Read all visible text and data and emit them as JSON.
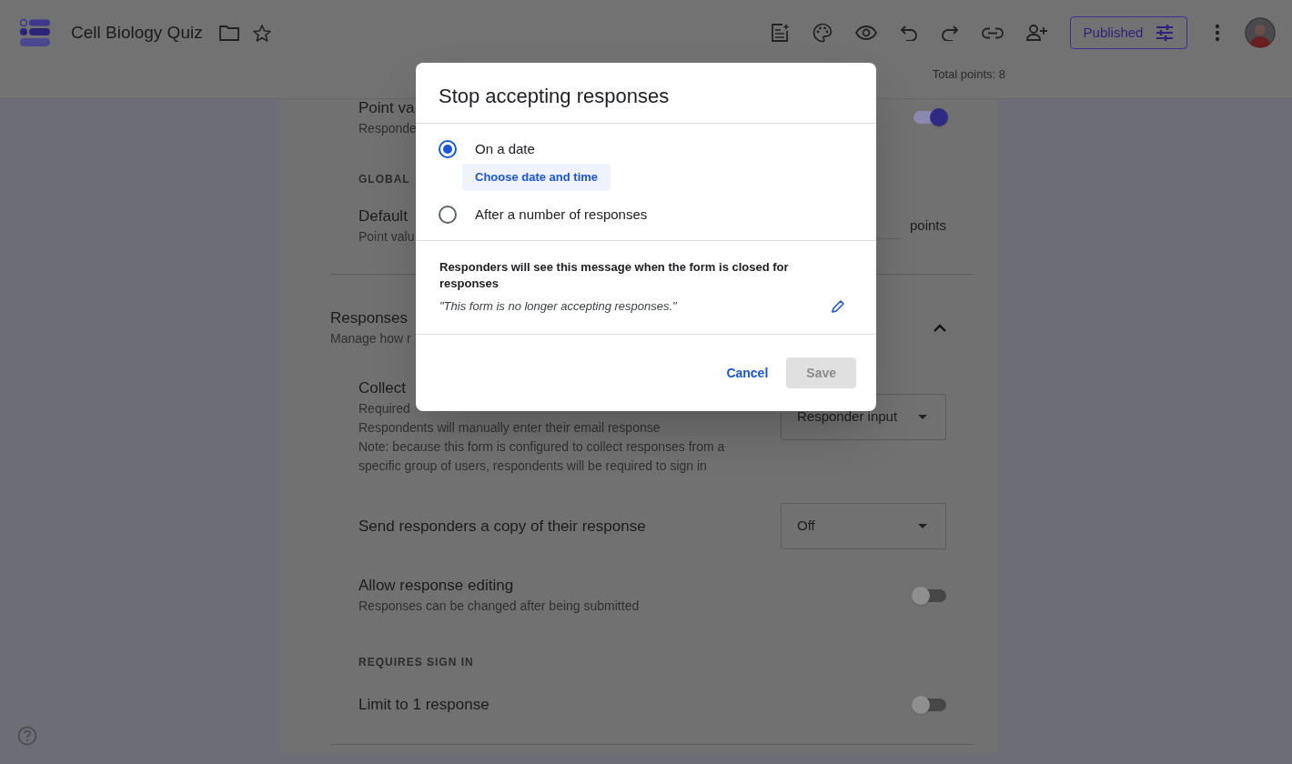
{
  "app": {
    "title": "Cell Biology Quiz",
    "starred": false,
    "publish_button": "Published",
    "total_points": "Total points: 8"
  },
  "settings": [
    {
      "kind": "toggle",
      "title": "Point va",
      "lines": [
        "Responde"
      ],
      "on": true
    },
    {
      "kind": "heading",
      "label": "GLOBAL"
    },
    {
      "kind": "points",
      "title": "Default",
      "lines": [
        "Point valu"
      ],
      "unit": "points"
    },
    {
      "kind": "section",
      "title": "Responses",
      "lines": [
        "Manage how r"
      ],
      "expanded": true
    },
    {
      "kind": "dropdown",
      "title": "Collect",
      "lines": [
        "Required",
        "Respondents will manually enter their email response",
        "Note: because this form is configured to collect responses from a specific group of users, respondents will be required to sign in"
      ],
      "value": "Responder input"
    },
    {
      "kind": "dropdown",
      "title": "Send responders a copy of their response",
      "value": "Off"
    },
    {
      "kind": "toggle",
      "title": "Allow response editing",
      "lines": [
        "Responses can be changed after being submitted"
      ],
      "on": false
    },
    {
      "kind": "heading",
      "label": "REQUIRES SIGN IN"
    },
    {
      "kind": "toggle",
      "title": "Limit to 1 response",
      "on": false
    }
  ],
  "dialog": {
    "title": "Stop accepting responses",
    "options": [
      {
        "label": "On a date",
        "selected": true,
        "action": "Choose date and time"
      },
      {
        "label": "After a number of responses",
        "selected": false
      }
    ],
    "message_heading": "Responders will see this message when the form is closed for responses",
    "message": "\"This form is no longer accepting responses.\"",
    "buttons": [
      {
        "label": "Cancel",
        "kind": "text",
        "disabled": false
      },
      {
        "label": "Save",
        "kind": "filled",
        "disabled": true
      }
    ]
  }
}
